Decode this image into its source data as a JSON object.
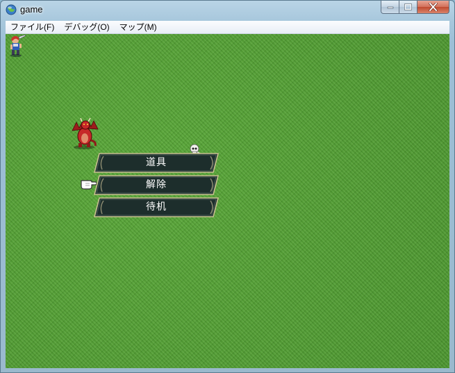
{
  "window": {
    "title": "game"
  },
  "menubar": {
    "items": [
      {
        "label": "ファイル(F)"
      },
      {
        "label": "デバッグ(O)"
      },
      {
        "label": "マップ(M)"
      }
    ]
  },
  "commands": {
    "items": [
      {
        "label": "道具"
      },
      {
        "label": "解除"
      },
      {
        "label": "待机"
      }
    ],
    "selected_index": 1
  },
  "colors": {
    "grass": "#4e9a33",
    "command_bg": "#1d2e2c",
    "command_border": "#c8c090"
  }
}
